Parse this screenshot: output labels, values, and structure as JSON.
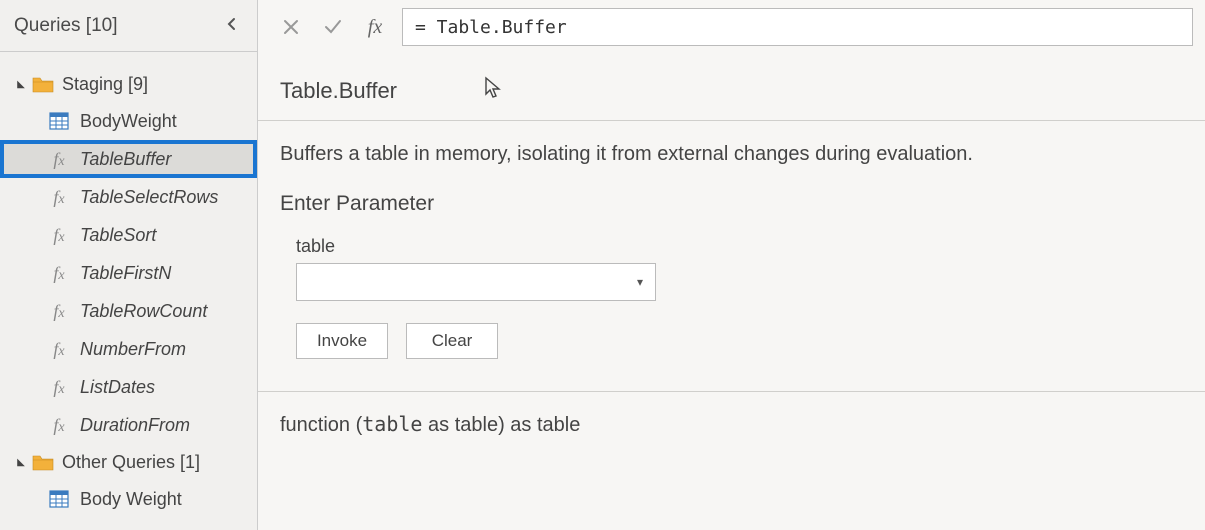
{
  "sidebar": {
    "title": "Queries [10]",
    "groups": [
      {
        "label": "Staging [9]",
        "items": [
          {
            "label": "BodyWeight",
            "icon": "table",
            "selected": false,
            "italic": false
          },
          {
            "label": "TableBuffer",
            "icon": "fx",
            "selected": true,
            "italic": true
          },
          {
            "label": "TableSelectRows",
            "icon": "fx",
            "selected": false,
            "italic": true
          },
          {
            "label": "TableSort",
            "icon": "fx",
            "selected": false,
            "italic": true
          },
          {
            "label": "TableFirstN",
            "icon": "fx",
            "selected": false,
            "italic": true
          },
          {
            "label": "TableRowCount",
            "icon": "fx",
            "selected": false,
            "italic": true
          },
          {
            "label": "NumberFrom",
            "icon": "fx",
            "selected": false,
            "italic": true
          },
          {
            "label": "ListDates",
            "icon": "fx",
            "selected": false,
            "italic": true
          },
          {
            "label": "DurationFrom",
            "icon": "fx",
            "selected": false,
            "italic": true
          }
        ]
      },
      {
        "label": "Other Queries [1]",
        "items": [
          {
            "label": "Body Weight",
            "icon": "table",
            "selected": false,
            "italic": false
          }
        ]
      }
    ]
  },
  "formula_bar": {
    "fx_label": "fx",
    "value": "= Table.Buffer"
  },
  "function": {
    "name": "Table.Buffer",
    "description": "Buffers a table in memory, isolating it from external changes during evaluation."
  },
  "parameter": {
    "heading": "Enter Parameter",
    "label": "table",
    "selected_value": ""
  },
  "buttons": {
    "invoke": "Invoke",
    "clear": "Clear"
  },
  "signature": {
    "prefix": "function (",
    "arg_name": "table",
    "mid": " as table) as table"
  }
}
